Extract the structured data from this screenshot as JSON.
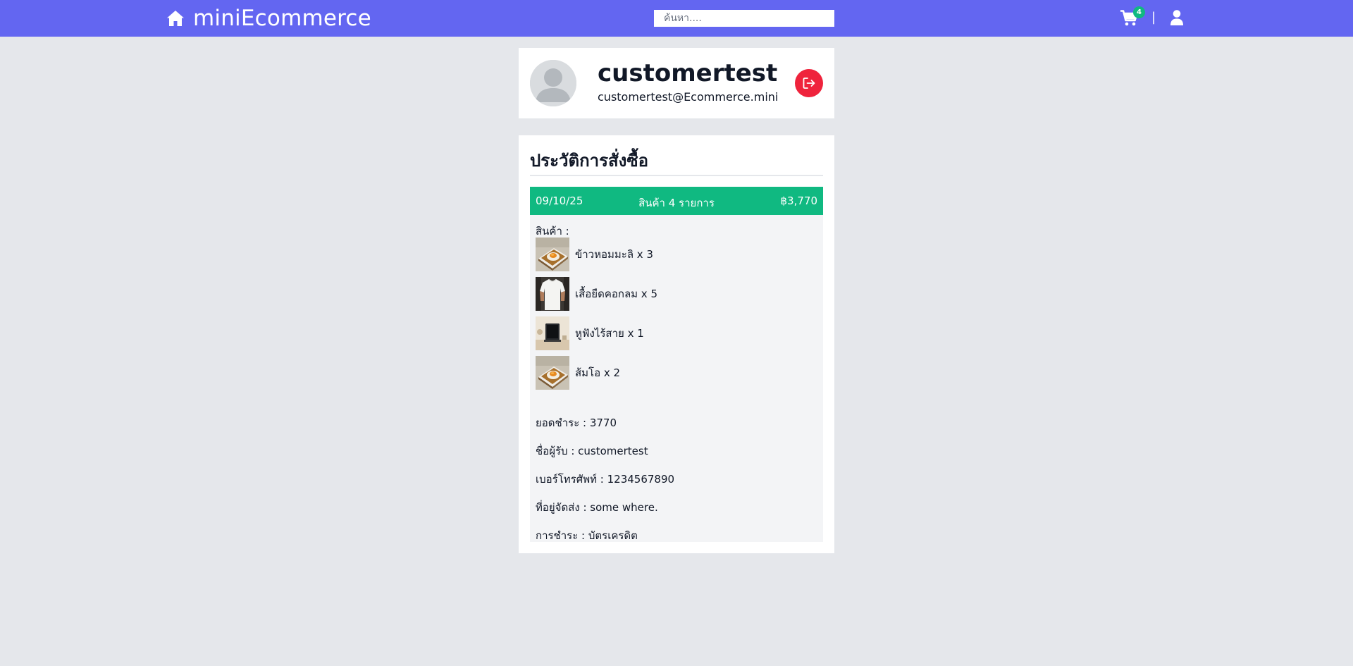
{
  "header": {
    "brand": "miniEcommerce",
    "search_placeholder": "ค้นหา....",
    "cart_count": "4",
    "divider": "|"
  },
  "profile": {
    "name": "customertest",
    "email": "customertest@Ecommerce.mini"
  },
  "history": {
    "title": "ประวัติการสั่งซื้อ",
    "orders": [
      {
        "date": "09/10/25",
        "count_text": "สินค้า 4 รายการ",
        "total": "฿3,770",
        "items_label": "สินค้า :",
        "items": [
          {
            "name": "ข้าวหอมมะลิ x 3",
            "thumb": "rice-dish"
          },
          {
            "name": "เสื้อยืดคอกลม x 5",
            "thumb": "white-tshirt"
          },
          {
            "name": "หูฟังไร้สาย x 1",
            "thumb": "tablet-device"
          },
          {
            "name": "ส้มโอ x 2",
            "thumb": "rice-dish"
          }
        ],
        "amount": "ยอดชำระ : 3770",
        "recipient": "ชื่อผู้รับ : customertest",
        "phone": "เบอร์โทรศัพท์ : 1234567890",
        "address": "ที่อยู่จัดส่ง : some where.",
        "payment": "การชำระ : บัตรเครดิต"
      }
    ]
  },
  "colors": {
    "navbar": "#6366f1",
    "order_header": "#10b981",
    "badge": "#10b981",
    "logout": "#ef233c",
    "page_bg": "#e5e7eb"
  }
}
